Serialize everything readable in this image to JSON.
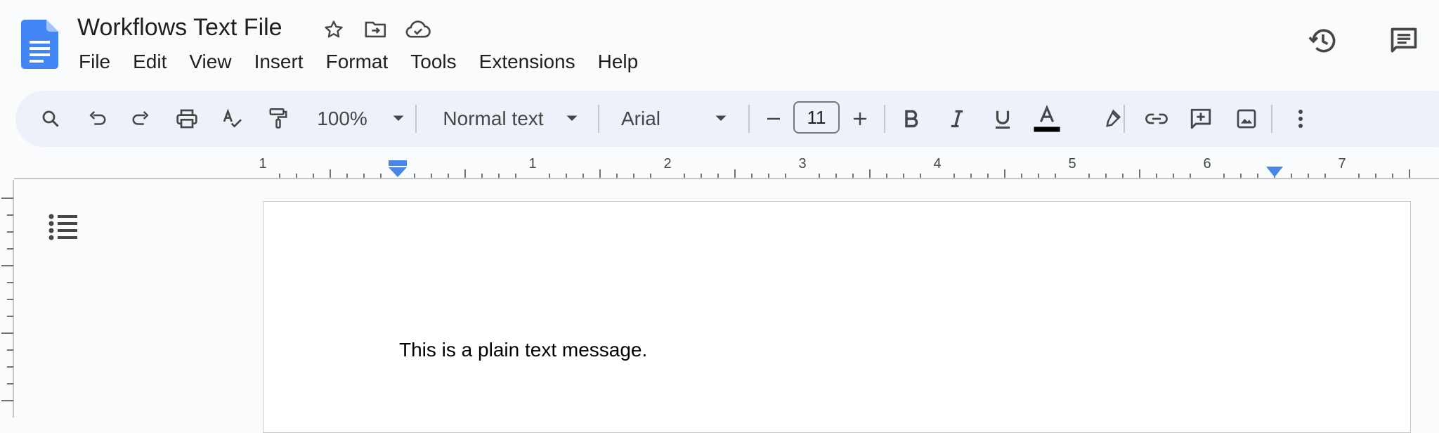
{
  "document": {
    "title": "Workflows Text File",
    "body_text": "This is a plain text message."
  },
  "menubar": {
    "items": [
      "File",
      "Edit",
      "View",
      "Insert",
      "Format",
      "Tools",
      "Extensions",
      "Help"
    ]
  },
  "toolbar": {
    "zoom": "100%",
    "style": "Normal text",
    "font": "Arial",
    "font_size": "11"
  },
  "ruler": {
    "labels": [
      "1",
      "1",
      "2",
      "3",
      "4",
      "5",
      "6",
      "7"
    ]
  },
  "icons": {
    "title": [
      "star-icon",
      "move-to-folder-icon",
      "cloud-saved-icon"
    ],
    "right": [
      "version-history-icon",
      "comments-icon"
    ],
    "toolbar": [
      "search-icon",
      "undo-icon",
      "redo-icon",
      "print-icon",
      "spellcheck-icon",
      "paint-format-icon",
      "zoom-dropdown-icon",
      "style-dropdown-icon",
      "font-dropdown-icon",
      "decrease-font-icon",
      "increase-font-icon",
      "bold-icon",
      "italic-icon",
      "underline-icon",
      "text-color-icon",
      "highlight-icon",
      "link-icon",
      "add-comment-icon",
      "insert-image-icon",
      "more-icon"
    ]
  },
  "colors": {
    "docs_blue": "#4285f4",
    "toolbar_bg": "#edf2fa",
    "text_color_bar": "#000000",
    "ruler_marker": "#4a86e8"
  }
}
